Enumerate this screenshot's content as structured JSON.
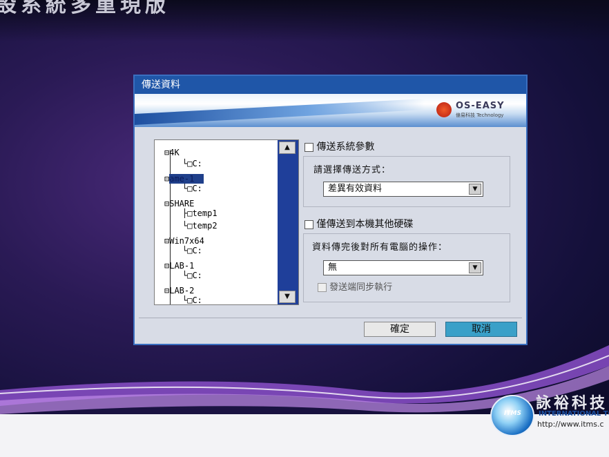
{
  "background": {
    "title": "設系統多重現版",
    "brand_cn": "詠裕科技",
    "brand_en": "INTERNATIONAL TO",
    "brand_url": "http://www.itms.c",
    "logo_text": "ITMS"
  },
  "dialog": {
    "title": "傳送資料",
    "brand_name": "OS-EASY",
    "brand_sub": "億易科技 Technology",
    "tree": [
      {
        "label": "4K",
        "children": [
          "C:"
        ]
      },
      {
        "label": "ame-1",
        "children": [
          "C:"
        ],
        "selected": true
      },
      {
        "label": "SHARE",
        "children": [
          "temp1",
          "temp2"
        ]
      },
      {
        "label": "Win7x64",
        "children": [
          "C:"
        ]
      },
      {
        "label": "LAB-1",
        "children": [
          "C:"
        ]
      },
      {
        "label": "LAB-2",
        "children": [
          "C:"
        ]
      }
    ],
    "transfer_system_params": "傳送系統參數",
    "method_label": "請選擇傳送方式：",
    "method_value": "差異有效資料",
    "only_local_disk": "僅傳送到本機其他硬碟",
    "after_label": "資料傳完後對所有電腦的操作：",
    "after_value": "無",
    "sync_exec": "發送端同步執行",
    "ok": "確定",
    "cancel": "取消"
  }
}
